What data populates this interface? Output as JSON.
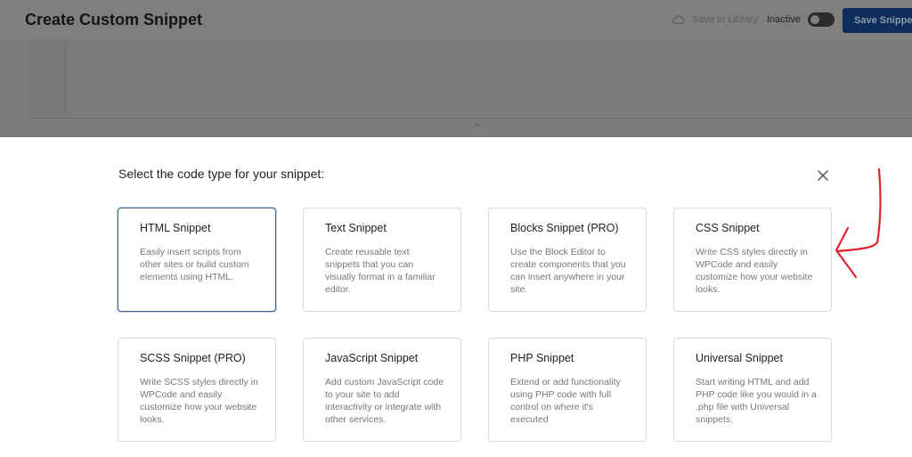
{
  "header": {
    "title": "Create Custom Snippet",
    "save_to_library": "Save to Library",
    "status": "Inactive",
    "save_button": "Save Snippet"
  },
  "modal": {
    "heading": "Select the code type for your snippet:",
    "cards": [
      {
        "title": "HTML Snippet",
        "description": "Easily insert scripts from other sites or build custom elements using HTML."
      },
      {
        "title": "Text Snippet",
        "description": "Create reusable text snippets that you can visually format in a familiar editor."
      },
      {
        "title": "Blocks Snippet (PRO)",
        "description": "Use the Block Editor to create components that you can insert anywhere in your site."
      },
      {
        "title": "CSS Snippet",
        "description": "Write CSS styles directly in WPCode and easily customize how your website looks."
      },
      {
        "title": "SCSS Snippet (PRO)",
        "description": "Write SCSS styles directly in WPCode and easily customize how your website looks."
      },
      {
        "title": "JavaScript Snippet",
        "description": "Add custom JavaScript code to your site to add interactivity or integrate with other services."
      },
      {
        "title": "PHP Snippet",
        "description": "Extend or add functionality using PHP code with full control on where it's executed"
      },
      {
        "title": "Universal Snippet",
        "description": "Start writing HTML and add PHP code like you would in a .php file with Universal snippets."
      }
    ]
  },
  "colors": {
    "accent": "#0d2d5c",
    "selected_border": "#3a5f8f",
    "annotation_arrow": "#e0242a"
  },
  "icons": [
    "cloud-icon",
    "close-icon",
    "resize-handle-icon"
  ]
}
